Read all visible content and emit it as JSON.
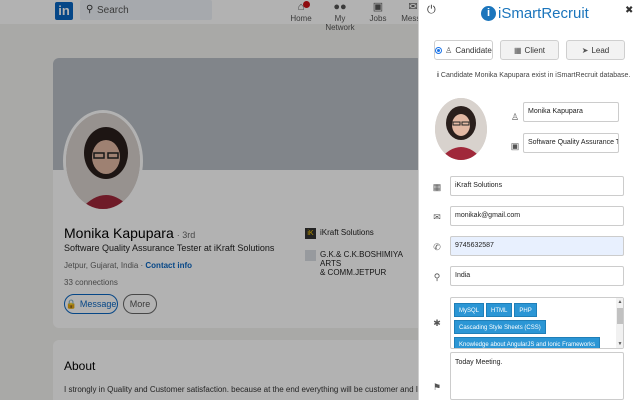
{
  "linkedin": {
    "logo": "in",
    "search_placeholder": "Search",
    "nav": [
      {
        "label": "Home",
        "icon": "home-icon",
        "glyph": "⌂"
      },
      {
        "label": "My Network",
        "icon": "network-icon",
        "glyph": "👥"
      },
      {
        "label": "Jobs",
        "icon": "briefcase-icon",
        "glyph": "💼"
      },
      {
        "label": "Messa",
        "icon": "message-icon",
        "glyph": "💬"
      }
    ],
    "profile": {
      "name": "Monika Kapupara",
      "degree": "· 3rd",
      "headline": "Software Quality Assurance Tester at iKraft Solutions",
      "location": "Jetpur, Gujarat, India ·",
      "contact_info": "Contact info",
      "connections": "33 connections",
      "message_btn": "Message",
      "more_btn": "More",
      "company": "iKraft Solutions",
      "education_line1": "G.K.& C.K.BOSHIMIYA ARTS",
      "education_line2": "& COMM.JETPUR"
    },
    "about": {
      "title": "About",
      "text": "I strongly in Quality and Customer satisfaction. because at the end everything will be customer and I wanted to"
    }
  },
  "panel": {
    "brand": "iSmartRecruit",
    "brand_mark": "i",
    "tabs": [
      {
        "label": "Candidate",
        "icon": "user-icon",
        "active": true
      },
      {
        "label": "Client",
        "icon": "building-icon",
        "active": false
      },
      {
        "label": "Lead",
        "icon": "location-arrow-icon",
        "active": false
      }
    ],
    "info": "Candidate Monika Kapupara exist in iSmartRecruit database.",
    "name_value": "Monika  Kapupara",
    "title_value": "Software Quality Assurance T",
    "company_value": "iKraft Solutions",
    "email_value": "monikak@gmail.com",
    "phone_value": "9745632587",
    "location_value": "India",
    "skills": [
      "MySQL",
      "HTML",
      "PHP",
      "Cascading Style Sheets (CSS)",
      "Knowledge about AngularJS and Ionic Frameworks"
    ],
    "notes_value": "Today Meeting.",
    "colors": {
      "brand": "#1b75bc",
      "chip": "#2b96d5",
      "phone_highlight": "#e8f0fe"
    }
  }
}
